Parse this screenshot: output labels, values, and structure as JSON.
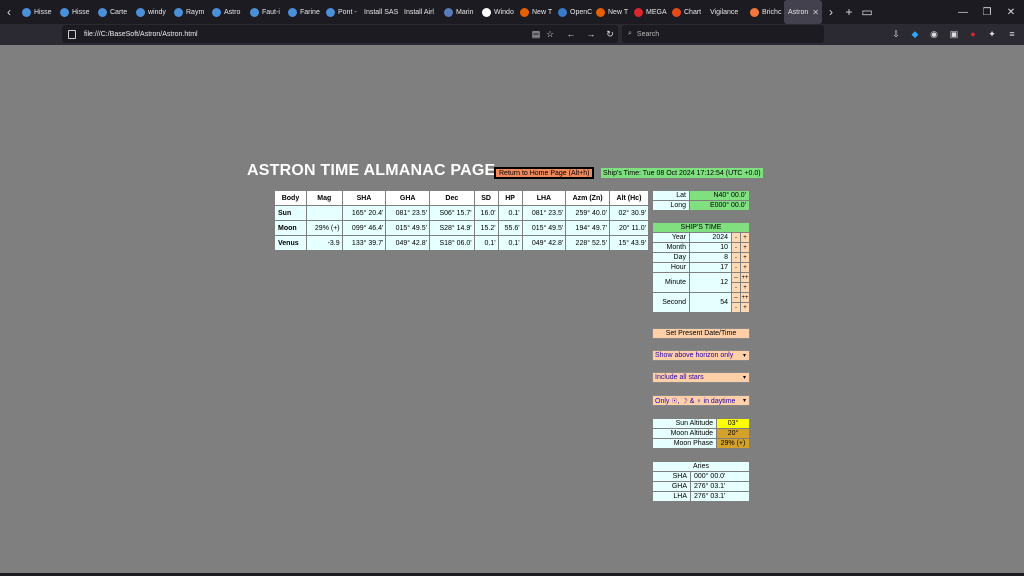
{
  "browser": {
    "tabs": [
      {
        "label": "Hisse",
        "color": "#4a90d9"
      },
      {
        "label": "Hisse",
        "color": "#4a90d9"
      },
      {
        "label": "Carte",
        "color": "#4a90d9"
      },
      {
        "label": "windy",
        "color": "#4a90d9"
      },
      {
        "label": "Raym",
        "color": "#4a90d9"
      },
      {
        "label": "Astro",
        "color": "#4a90d9"
      },
      {
        "label": "Faut-i",
        "color": "#4a90d9"
      },
      {
        "label": "Farine",
        "color": "#4a90d9"
      },
      {
        "label": "Pont -",
        "color": "#4a90d9"
      },
      {
        "label": "Install SAS",
        "color": ""
      },
      {
        "label": "Install Airl",
        "color": ""
      },
      {
        "label": "Marin",
        "color": "#5a7ab8"
      },
      {
        "label": "Windo",
        "color": "#ffffff"
      },
      {
        "label": "New T",
        "color": "#e66000"
      },
      {
        "label": "OpenC",
        "color": "#3a7ac8"
      },
      {
        "label": "New T",
        "color": "#e66000"
      },
      {
        "label": "MEGA",
        "color": "#d9272e"
      },
      {
        "label": "Chart",
        "color": "#e64a19"
      },
      {
        "label": "Vigilance",
        "color": ""
      },
      {
        "label": "Brichc",
        "color": "#f0783c"
      },
      {
        "label": "Astron",
        "color": "",
        "active": true
      }
    ],
    "url": "file:///C:/BaseSoft/Astron/Astron.html",
    "search_placeholder": "Search"
  },
  "page": {
    "title": "ASTRON TIME ALMANAC PAGE",
    "home_button": "Return to Home Page (Alt+h)",
    "ships_time": "Ship's Time: Tue 08 Oct 2024 17:12:54 (UTC +0.0)"
  },
  "almanac": {
    "headers": [
      "Body",
      "Mag",
      "SHA",
      "GHA",
      "Dec",
      "SD",
      "HP",
      "LHA",
      "Azm (Zn)",
      "Alt (Hc)"
    ],
    "rows": [
      [
        "Sun",
        "",
        "165° 20.4'",
        "081° 23.5'",
        "S06° 15.7'",
        "16.0'",
        "0.1'",
        "081° 23.5'",
        "259° 40.0'",
        "02° 30.9'"
      ],
      [
        "Moon",
        "29% (+)",
        "099° 46.4'",
        "015° 49.5'",
        "S28° 14.9'",
        "15.2'",
        "55.6'",
        "015° 49.5'",
        "194° 49.7'",
        "20° 11.0'"
      ],
      [
        "Venus",
        "-3.9",
        "133° 39.7'",
        "049° 42.8'",
        "S18° 06.0'",
        "0.1'",
        "0.1'",
        "049° 42.8'",
        "228° 52.5'",
        "15° 43.9'"
      ]
    ]
  },
  "position": {
    "lat_label": "Lat",
    "lat_value": "N40° 00.0'",
    "long_label": "Long",
    "long_value": "E000° 00.0'"
  },
  "ships_time_panel": {
    "header": "SHIP'S TIME",
    "year_label": "Year",
    "year_value": "2024",
    "month_label": "Month",
    "month_value": "10",
    "day_label": "Day",
    "day_value": "8",
    "hour_label": "Hour",
    "hour_value": "17",
    "minute_label": "Minute",
    "minute_value": "12",
    "second_label": "Second",
    "second_value": "54",
    "minus": "-",
    "plus": "+",
    "minus2": "--",
    "plus2": "++"
  },
  "controls": {
    "set_present": "Set Present Date/Time",
    "horizon_select": "Show above horizon only",
    "stars_select": "Include all stars",
    "daytime_select": "Only ☉, ☽ & ♀ in daytime"
  },
  "altitudes": {
    "sun_label": "Sun Altitude",
    "sun_value": "03°",
    "moon_label": "Moon Altitude",
    "moon_value": "20°",
    "phase_label": "Moon Phase",
    "phase_value": "29% (+)"
  },
  "aries": {
    "header": "Aries",
    "sha_label": "SHA",
    "sha_value": "000° 00.0'",
    "gha_label": "GHA",
    "gha_value": "276° 03.1'",
    "lha_label": "LHA",
    "lha_value": "276° 03.1'"
  }
}
